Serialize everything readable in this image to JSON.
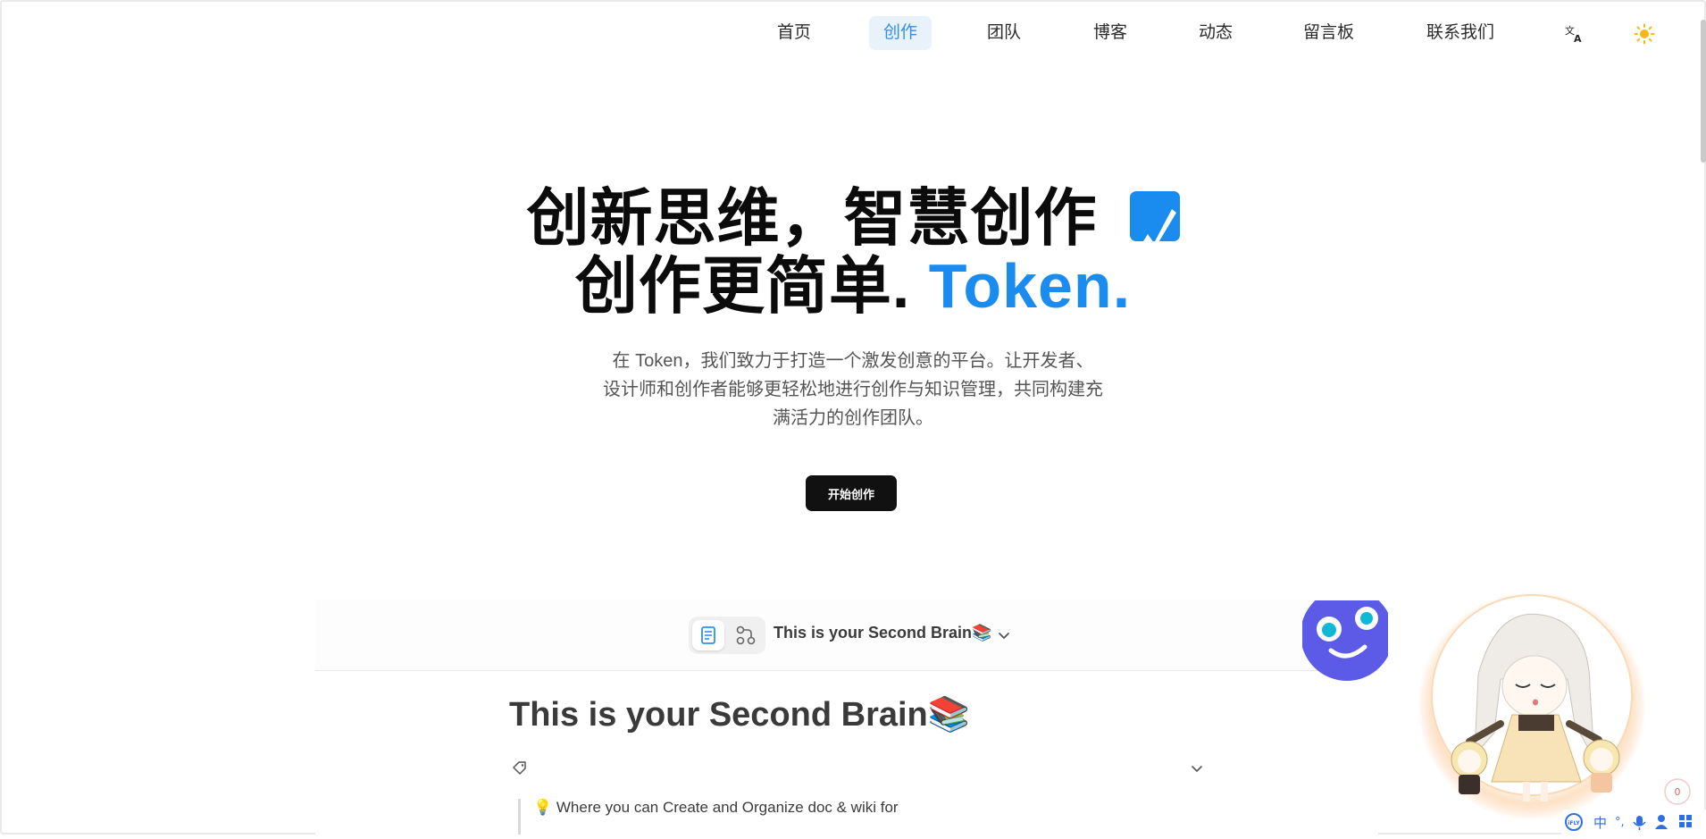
{
  "nav": {
    "items": [
      {
        "label": "首页",
        "active": false
      },
      {
        "label": "创作",
        "active": true
      },
      {
        "label": "团队",
        "active": false
      },
      {
        "label": "博客",
        "active": false
      },
      {
        "label": "动态",
        "active": false
      },
      {
        "label": "留言板",
        "active": false
      },
      {
        "label": "联系我们",
        "active": false
      }
    ],
    "translate_icon": "translate-icon",
    "theme_icon": "sun-icon"
  },
  "hero": {
    "line1": "创新思维，智慧创作",
    "line2_main": "创作更简单.",
    "line2_accent": "Token.",
    "accent_color": "#1a8cf0",
    "description_lines": [
      "在 Token，我们致力于打造一个激发创意的平台。让开发者、",
      "设计师和创作者能够更轻松地进行创作与知识管理，共同构建充",
      "满活力的创作团队。"
    ],
    "cta_label": "开始创作"
  },
  "preview": {
    "header_title": "This is your Second Brain📚",
    "doc_title": "This is your Second Brain📚",
    "quote": "💡 Where you can Create and Organize doc & wiki  for"
  },
  "widgets": {
    "counter": "0",
    "ime_label": "中"
  }
}
